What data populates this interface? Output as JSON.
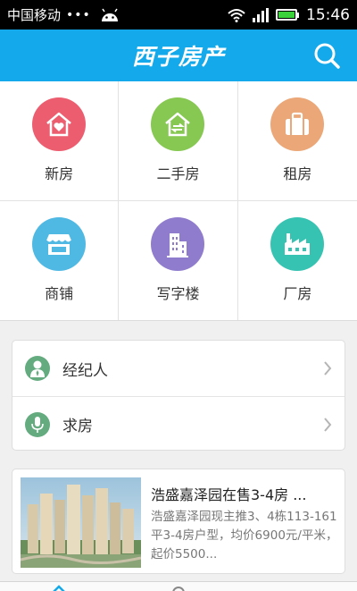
{
  "status_bar": {
    "carrier": "中国移动",
    "dots": "•••",
    "time": "15:46"
  },
  "header": {
    "title": "西子房产",
    "search_icon": "search-icon"
  },
  "categories": [
    {
      "label": "新房",
      "icon": "house-heart-icon",
      "color": "#ec5d70"
    },
    {
      "label": "二手房",
      "icon": "house-exchange-icon",
      "color": "#86c852"
    },
    {
      "label": "租房",
      "icon": "suitcase-icon",
      "color": "#eba777"
    },
    {
      "label": "商铺",
      "icon": "shop-icon",
      "color": "#50b9e3"
    },
    {
      "label": "写字楼",
      "icon": "office-building-icon",
      "color": "#8f7ccc"
    },
    {
      "label": "厂房",
      "icon": "factory-icon",
      "color": "#37c3b1"
    }
  ],
  "menu": [
    {
      "label": "经纪人",
      "icon": "agent-icon"
    },
    {
      "label": "求房",
      "icon": "microphone-icon"
    }
  ],
  "news": {
    "title": "浩盛嘉泽园在售3-4房 ...",
    "description": "浩盛嘉泽园现主推3、4栋113-161平3-4房户型，均价6900元/平米，起价5500..."
  },
  "colors": {
    "header": "#13a9ea",
    "menu_icon": "#65ab80"
  }
}
